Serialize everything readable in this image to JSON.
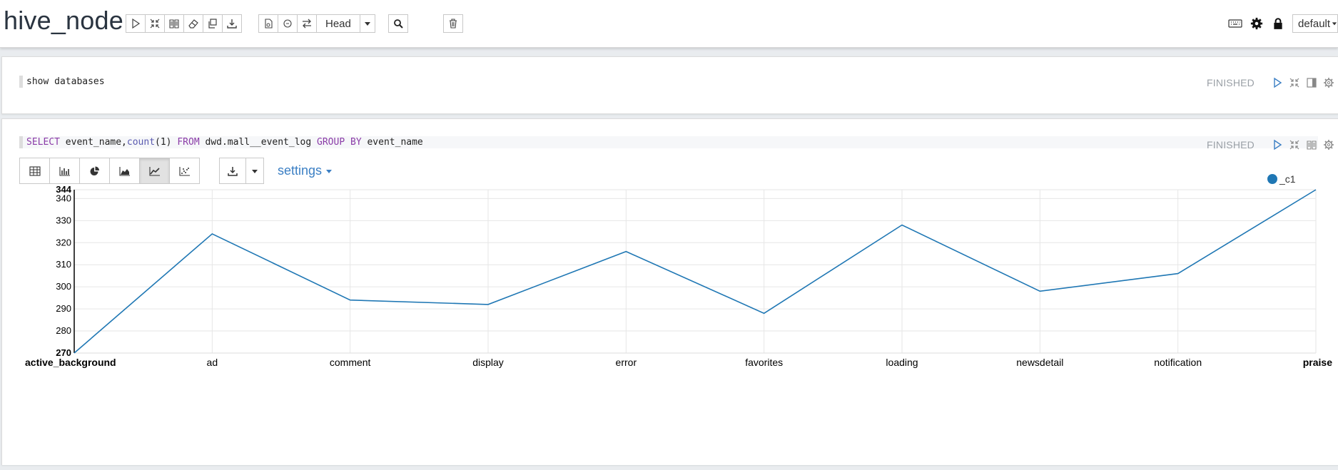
{
  "app": {
    "title": "hive_node"
  },
  "toolbar": {
    "head_label": "Head",
    "default_label": "default",
    "icons": [
      "run-all-icon",
      "collapse-icon",
      "book-icon",
      "eraser-icon",
      "clone-icon",
      "export-icon",
      "note-info-icon",
      "clock-icon",
      "swap-icon",
      "search-icon",
      "trash-icon",
      "keyboard-icon",
      "gear-icon",
      "lock-icon"
    ]
  },
  "paragraphs": [
    {
      "code": "show databases",
      "status": "FINISHED"
    },
    {
      "code_parts": {
        "k1": "SELECT",
        "t1": " event_name,",
        "fn": "count",
        "t2": "(1) ",
        "k2": "FROM",
        "t3": " dwd.mall__event_log ",
        "k3": "GROUP BY",
        "t4": " event_name"
      },
      "status": "FINISHED",
      "settings_label": "settings",
      "viz_buttons": [
        "table-icon",
        "bar-chart-icon",
        "pie-chart-icon",
        "area-chart-icon",
        "line-chart-icon",
        "scatter-chart-icon"
      ],
      "active_viz": "line-chart-icon"
    }
  ],
  "chart_data": {
    "type": "line",
    "categories": [
      "active_background",
      "ad",
      "comment",
      "display",
      "error",
      "favorites",
      "loading",
      "newsdetail",
      "notification",
      "praise"
    ],
    "series": [
      {
        "name": "_c1",
        "values": [
          270,
          324,
          294,
          292,
          316,
          288,
          328,
          298,
          306,
          344
        ],
        "color": "#1f77b4"
      }
    ],
    "ylim": [
      270,
      344
    ],
    "yticks": [
      270,
      280,
      290,
      300,
      310,
      320,
      330,
      340,
      344
    ],
    "grid": true,
    "legend": "top-right"
  }
}
